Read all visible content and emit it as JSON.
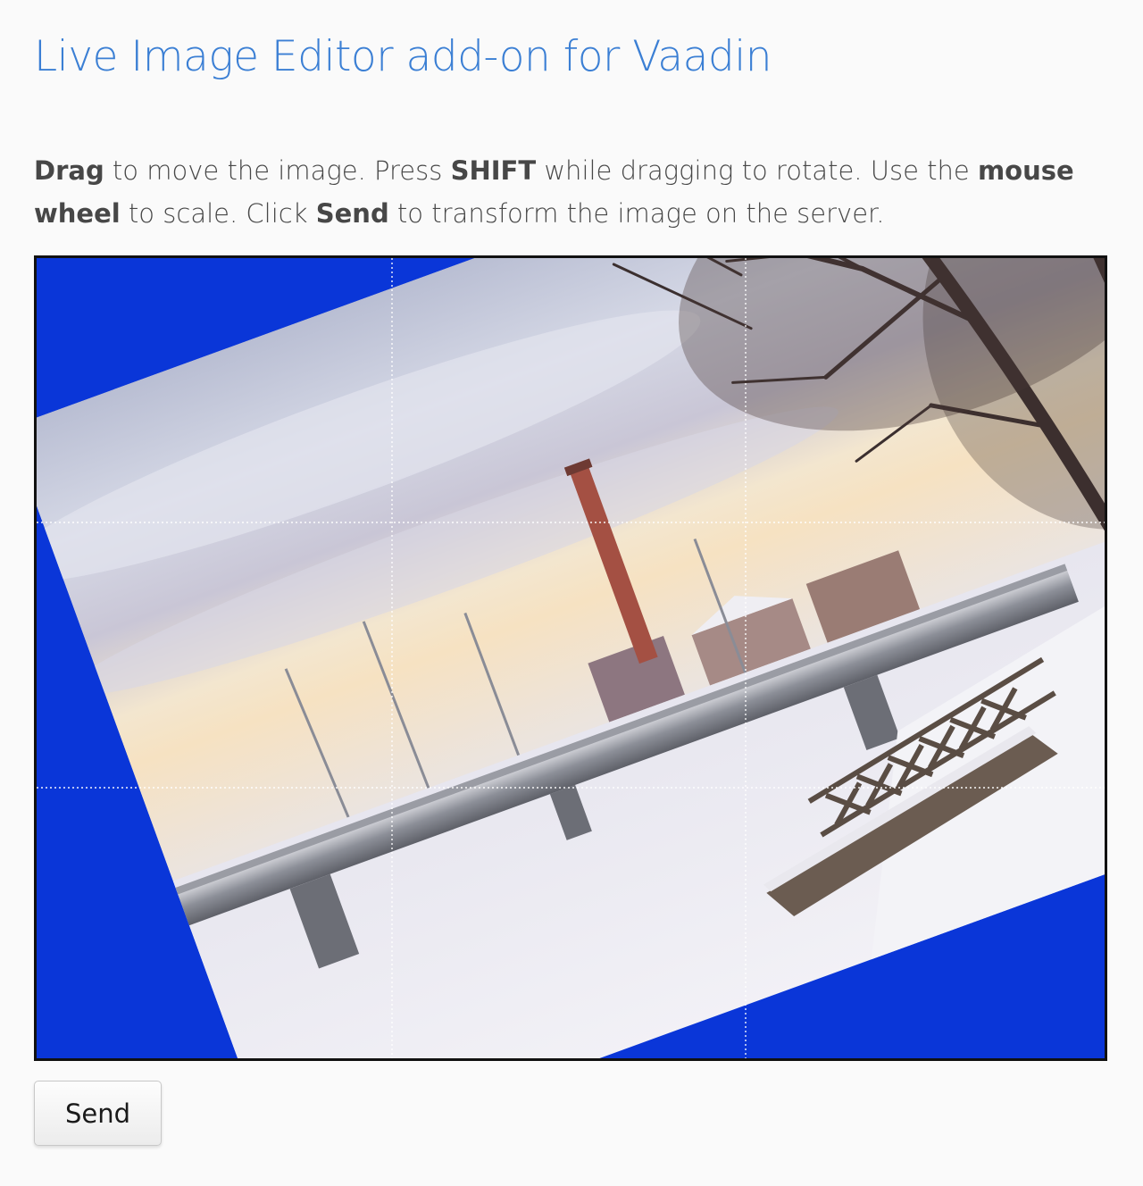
{
  "page": {
    "title": "Live Image Editor add-on for Vaadin"
  },
  "instructions": {
    "drag_word": "Drag",
    "text1": " to move the image. Press ",
    "shift_word": "SHIFT",
    "text2": " while dragging to rotate. Use the ",
    "wheel_word": "mouse wheel",
    "text3": " to scale. Click ",
    "send_word": "Send",
    "text4": " to transform the image on the server."
  },
  "editor": {
    "background_color": "#0a36d8",
    "image_rotation_deg": -20,
    "grid": "3x3 dotted guide lines"
  },
  "actions": {
    "send_label": "Send"
  }
}
